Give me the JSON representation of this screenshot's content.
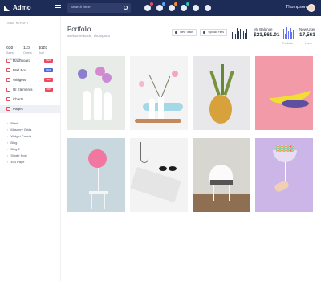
{
  "header": {
    "app_name": "Admo",
    "search_placeholder": "Search here",
    "user_name": "Thompson",
    "icons": [
      "gift-icon",
      "bell-icon",
      "mail-icon",
      "user-icon",
      "cross-icon",
      "settings-icon"
    ],
    "badge_colors": [
      "#ef4b5d",
      "#59a7ff",
      "#ff8b2a",
      "#2ec4b6"
    ]
  },
  "sidebar": {
    "team_report_title": "TEAM REPORT",
    "stats": [
      {
        "value": "638",
        "label": "Sales"
      },
      {
        "value": "115",
        "label": "Orders"
      },
      {
        "value": "$128",
        "label": "Sum"
      }
    ],
    "section_title": "WIDGETS",
    "items": [
      {
        "label": "Dashboard",
        "badge": "NEW",
        "badge_color": "#ef4b5d"
      },
      {
        "label": "Mail Box",
        "badge": "NEW",
        "badge_color": "#4d66d5"
      },
      {
        "label": "Widgets",
        "badge": "NEW",
        "badge_color": "#ef4b5d"
      },
      {
        "label": "UI Elements",
        "badge": "HOT",
        "badge_color": "#ef4b5d"
      },
      {
        "label": "Charts",
        "badge": "",
        "badge_color": ""
      },
      {
        "label": "Pages",
        "badge": "",
        "badge_color": ""
      }
    ],
    "sub_items": [
      "Blank",
      "Masonry Grids",
      "Widget Panels",
      "Blog",
      "Blog 2",
      "Single Post",
      "404 Page"
    ]
  },
  "main": {
    "title": "Portfolio",
    "subtitle": "Welcome back, Thompson",
    "actions": [
      "New Tasks",
      "Upload Files"
    ],
    "metrics": [
      {
        "label": "My Balance",
        "value": "$21,561.01"
      },
      {
        "label": "New User",
        "value": "17,561"
      }
    ],
    "breadcrumb": [
      "Portfolio",
      "Home"
    ]
  }
}
